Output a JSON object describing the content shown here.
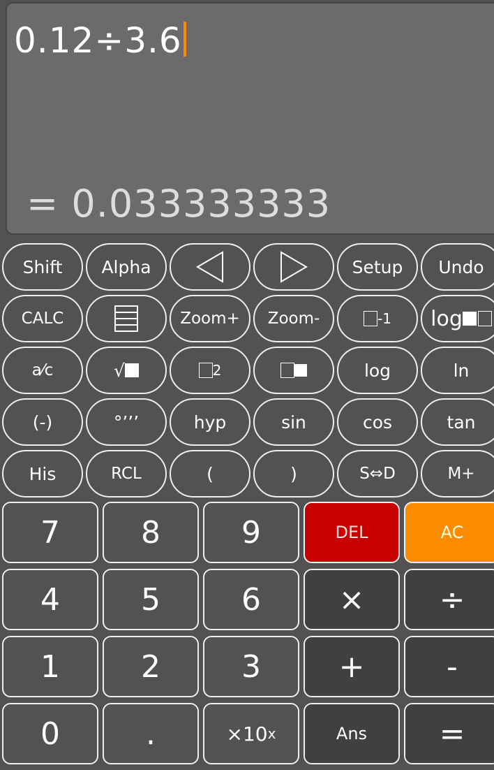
{
  "display": {
    "expression": "0.12÷3.6",
    "result": "= 0.033333333",
    "cursor_color": "#ff8c00"
  },
  "function_keys": [
    {
      "label": "Shift"
    },
    {
      "label": "Alpha"
    },
    {
      "label": "",
      "icon": "left-arrow-icon"
    },
    {
      "label": "",
      "icon": "right-arrow-icon"
    },
    {
      "label": "Setup"
    },
    {
      "label": "Undo"
    },
    {
      "label": "CALC"
    },
    {
      "label": "",
      "icon": "table-icon"
    },
    {
      "label": "Zoom+"
    },
    {
      "label": "Zoom-"
    },
    {
      "label": "-1",
      "icon": "inverse-icon"
    },
    {
      "label": "log",
      "icon": "log-base-icon"
    },
    {
      "label": "a⁄c"
    },
    {
      "label": "√",
      "icon": "sqrt-icon"
    },
    {
      "label": "2",
      "icon": "square-icon"
    },
    {
      "label": "",
      "icon": "power-icon"
    },
    {
      "label": "log"
    },
    {
      "label": "ln"
    },
    {
      "label": "(-)"
    },
    {
      "label": "°’’’"
    },
    {
      "label": "hyp"
    },
    {
      "label": "sin"
    },
    {
      "label": "cos"
    },
    {
      "label": "tan"
    },
    {
      "label": "His"
    },
    {
      "label": "RCL"
    },
    {
      "label": "("
    },
    {
      "label": ")"
    },
    {
      "label": "S⇔D"
    },
    {
      "label": "M+"
    }
  ],
  "keypad": [
    {
      "label": "7"
    },
    {
      "label": "8"
    },
    {
      "label": "9"
    },
    {
      "label": "DEL",
      "color": "#c80000"
    },
    {
      "label": "AC",
      "color": "#ff8c00"
    },
    {
      "label": "4"
    },
    {
      "label": "5"
    },
    {
      "label": "6"
    },
    {
      "label": "×"
    },
    {
      "label": "÷"
    },
    {
      "label": "1"
    },
    {
      "label": "2"
    },
    {
      "label": "3"
    },
    {
      "label": "+"
    },
    {
      "label": "-"
    },
    {
      "label": "0"
    },
    {
      "label": "."
    },
    {
      "label": "×10",
      "sup": "x"
    },
    {
      "label": "Ans"
    },
    {
      "label": "="
    }
  ]
}
